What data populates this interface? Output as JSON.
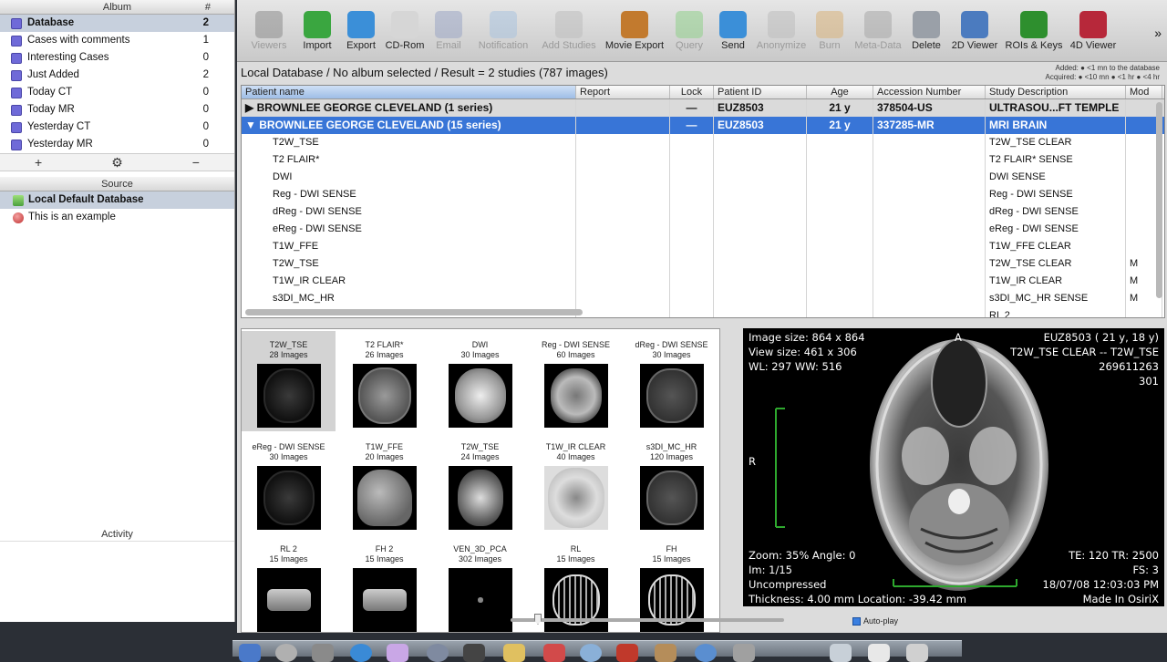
{
  "album_panel": {
    "header_album": "Album",
    "header_count": "#",
    "albums": [
      {
        "label": "Database",
        "count": "2",
        "selected": true
      },
      {
        "label": "Cases with comments",
        "count": "1"
      },
      {
        "label": "Interesting Cases",
        "count": "0"
      },
      {
        "label": "Just Added",
        "count": "2"
      },
      {
        "label": "Today CT",
        "count": "0"
      },
      {
        "label": "Today MR",
        "count": "0"
      },
      {
        "label": "Yesterday CT",
        "count": "0"
      },
      {
        "label": "Yesterday MR",
        "count": "0"
      }
    ],
    "tools": {
      "add": "+",
      "gear": "⚙",
      "remove": "−"
    },
    "source_header": "Source",
    "sources": [
      {
        "label": "Local Default Database",
        "selected": true
      },
      {
        "label": "This is an example"
      }
    ],
    "activity_header": "Activity"
  },
  "toolbar": [
    {
      "label": "Viewers",
      "enabled": false,
      "icon": "viewers-icon",
      "color": "#8d8d8d"
    },
    {
      "label": "Import",
      "enabled": true,
      "icon": "import-icon",
      "color": "#3aa640"
    },
    {
      "label": "Export",
      "enabled": true,
      "icon": "export-icon",
      "color": "#3b8fd8"
    },
    {
      "label": "CD-Rom",
      "enabled": true,
      "icon": "cd-icon",
      "color": "#d6d6d6"
    },
    {
      "label": "Email",
      "enabled": false,
      "icon": "email-icon",
      "color": "#9aa6c4"
    },
    {
      "label": "Notification",
      "enabled": false,
      "icon": "notification-icon",
      "color": "#a9c2de"
    },
    {
      "label": "Add Studies",
      "enabled": false,
      "icon": "add-studies-icon",
      "color": "#bdbdbd"
    },
    {
      "label": "Movie Export",
      "enabled": true,
      "icon": "movie-export-icon",
      "color": "#c27a2e"
    },
    {
      "label": "Query",
      "enabled": false,
      "icon": "query-icon",
      "color": "#8fd08a"
    },
    {
      "label": "Send",
      "enabled": true,
      "icon": "send-icon",
      "color": "#3b8fd8"
    },
    {
      "label": "Anonymize",
      "enabled": false,
      "icon": "anonymize-icon",
      "color": "#bdbdbd"
    },
    {
      "label": "Burn",
      "enabled": false,
      "icon": "burn-icon",
      "color": "#d9b27a"
    },
    {
      "label": "Meta-Data",
      "enabled": false,
      "icon": "metadata-icon",
      "color": "#a8a8a8"
    },
    {
      "label": "Delete",
      "enabled": true,
      "icon": "trash-icon",
      "color": "#9aa0a8"
    },
    {
      "label": "2D Viewer",
      "enabled": true,
      "icon": "2d-viewer-icon",
      "color": "#4b7bbf"
    },
    {
      "label": "ROIs & Keys",
      "enabled": true,
      "icon": "rois-keys-icon",
      "color": "#2e8f2e"
    },
    {
      "label": "4D Viewer",
      "enabled": true,
      "icon": "4d-viewer-icon",
      "color": "#b7283a"
    }
  ],
  "toolbar_more": "»",
  "path_bar": "Local Database / No album selected / Result = 2 studies (787 images)",
  "legend": {
    "line1": "Added: ● <1 mn to the database",
    "line2": "Acquired: ● <10 mn  ● <1 hr  ● <4 hr"
  },
  "table": {
    "columns": [
      "Patient name",
      "Report",
      "Lock",
      "Patient ID",
      "Age",
      "Accession Number",
      "Study Description",
      "Mod"
    ],
    "studies": [
      {
        "name": "BROWNLEE GEORGE CLEVELAND (1 series)",
        "lock": "—",
        "patient_id": "EUZ8503",
        "age": "21 y",
        "accession": "378504-US",
        "description": "ULTRASOU...FT TEMPLE",
        "expander": "▶"
      },
      {
        "name": "BROWNLEE GEORGE CLEVELAND (15 series)",
        "lock": "—",
        "patient_id": "EUZ8503",
        "age": "21 y",
        "accession": "337285-MR",
        "description": "MRI BRAIN",
        "expander": "▼"
      }
    ],
    "series": [
      {
        "name": "T2W_TSE",
        "description": "T2W_TSE CLEAR",
        "mod": ""
      },
      {
        "name": "T2 FLAIR*",
        "description": "T2 FLAIR* SENSE",
        "mod": ""
      },
      {
        "name": "DWI",
        "description": "DWI SENSE",
        "mod": ""
      },
      {
        "name": "Reg - DWI SENSE",
        "description": "Reg - DWI SENSE",
        "mod": ""
      },
      {
        "name": "dReg - DWI SENSE",
        "description": "dReg - DWI SENSE",
        "mod": ""
      },
      {
        "name": "eReg - DWI SENSE",
        "description": "eReg - DWI SENSE",
        "mod": ""
      },
      {
        "name": "T1W_FFE",
        "description": "T1W_FFE CLEAR",
        "mod": ""
      },
      {
        "name": "T2W_TSE",
        "description": "T2W_TSE CLEAR",
        "mod": "M"
      },
      {
        "name": "T1W_IR CLEAR",
        "description": "T1W_IR CLEAR",
        "mod": "M"
      },
      {
        "name": "s3DI_MC_HR",
        "description": "s3DI_MC_HR SENSE",
        "mod": "M"
      },
      {
        "name": "",
        "description": "RL 2",
        "mod": ""
      }
    ]
  },
  "thumbnails": [
    {
      "name": "T2W_TSE",
      "count": "28 Images",
      "kind": "axial-dark"
    },
    {
      "name": "T2 FLAIR*",
      "count": "26 Images",
      "kind": "axial-gray"
    },
    {
      "name": "DWI",
      "count": "30 Images",
      "kind": "axial-bright"
    },
    {
      "name": "Reg - DWI SENSE",
      "count": "60 Images",
      "kind": "axial-bright2"
    },
    {
      "name": "dReg - DWI SENSE",
      "count": "30 Images",
      "kind": "axial-mid"
    },
    {
      "name": "eReg - DWI SENSE",
      "count": "30 Images",
      "kind": "axial-dark"
    },
    {
      "name": "T1W_FFE",
      "count": "20 Images",
      "kind": "sagittal"
    },
    {
      "name": "T2W_TSE",
      "count": "24 Images",
      "kind": "coronal"
    },
    {
      "name": "T1W_IR CLEAR",
      "count": "40 Images",
      "kind": "coronal-bright"
    },
    {
      "name": "s3DI_MC_HR",
      "count": "120 Images",
      "kind": "axial-mid"
    },
    {
      "name": "RL 2",
      "count": "15 Images",
      "kind": "mip"
    },
    {
      "name": "FH 2",
      "count": "15 Images",
      "kind": "mip"
    },
    {
      "name": "VEN_3D_PCA",
      "count": "302 Images",
      "kind": "dots"
    },
    {
      "name": "RL",
      "count": "15 Images",
      "kind": "vessels"
    },
    {
      "name": "FH",
      "count": "15 Images",
      "kind": "vessels"
    }
  ],
  "viewer": {
    "top_left": [
      "Image size: 864 x 864",
      "View size: 461 x 306",
      "WL: 297 WW: 516"
    ],
    "top_right": [
      "EUZ8503 ( 21 y,  18 y)",
      "T2W_TSE CLEAR -- T2W_TSE",
      "269611263",
      "301"
    ],
    "orient_top": "A",
    "orient_left": "R",
    "bottom_left": [
      "Zoom: 35% Angle: 0",
      "Im: 1/15",
      "Uncompressed",
      "Thickness: 4.00 mm Location: -39.42 mm"
    ],
    "bottom_right": [
      "TE: 120 TR: 2500",
      "FS: 3",
      "18/07/08 12:03:03 PM",
      "Made In OsiriX"
    ]
  },
  "autoplay_label": "Auto-play",
  "image_position": 0.1
}
